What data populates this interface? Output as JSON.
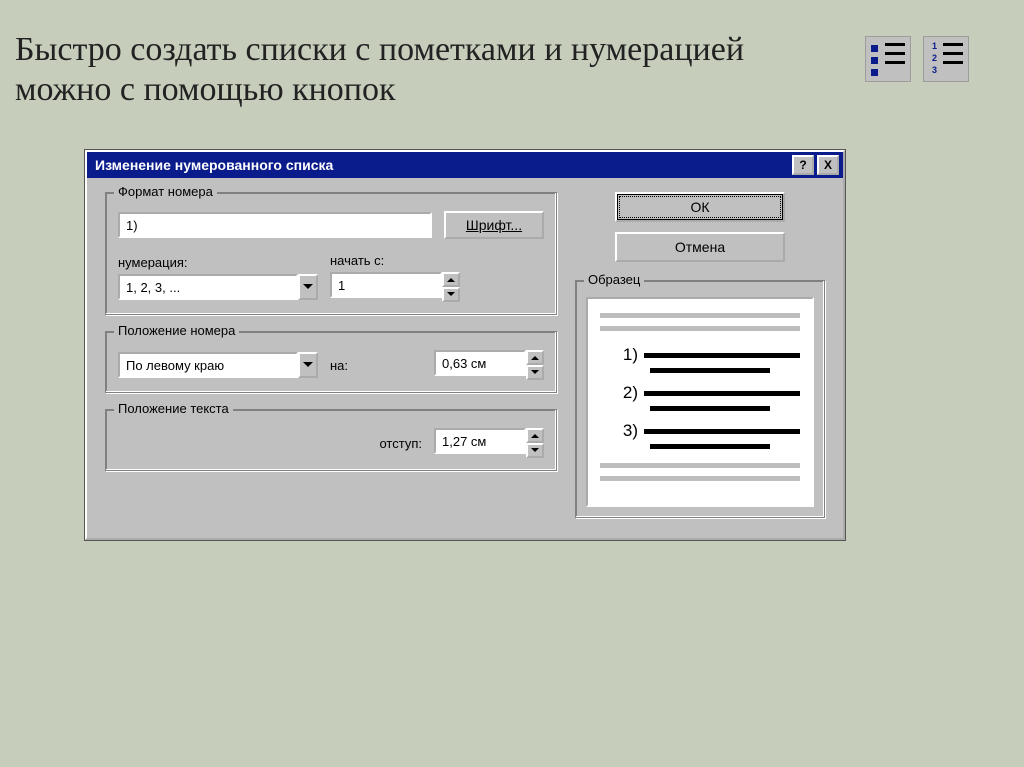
{
  "headline": "Быстро создать списки с пометками и нумерацией можно с помощью кнопок",
  "toolbar": {
    "bullet_icon": "bullet-list-icon",
    "number_icon": "number-list-icon"
  },
  "dialog": {
    "title": "Изменение нумерованного списка",
    "help": "?",
    "close": "X",
    "buttons": {
      "ok": "ОК",
      "cancel": "Отмена",
      "font": "Шрифт..."
    },
    "groups": {
      "format": "Формат номера",
      "position_number": "Положение номера",
      "position_text": "Положение текста",
      "sample": "Образец"
    },
    "fields": {
      "format_value": "1)",
      "numbering_label": "нумерация:",
      "numbering_value": "1, 2, 3, ...",
      "start_label": "начать с:",
      "start_value": "1",
      "align_value": "По левому краю",
      "at_label": "на:",
      "at_value": "0,63 см",
      "indent_label": "отступ:",
      "indent_value": "1,27 см"
    },
    "preview": {
      "items": [
        "1)",
        "2)",
        "3)"
      ]
    }
  }
}
